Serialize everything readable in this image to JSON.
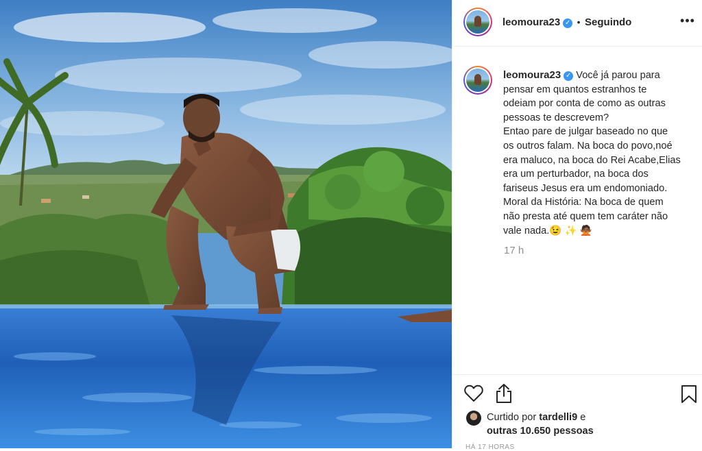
{
  "post": {
    "image_alt": "Homem agachado na borda de uma piscina com vista para vegetação e céu azul"
  },
  "header": {
    "username": "leomoura23",
    "verified_glyph": "✓",
    "separator": "•",
    "follow_status": "Seguindo",
    "more_icon": "more-options-icon",
    "more_glyph": "•••"
  },
  "caption": {
    "username": "leomoura23",
    "verified_glyph": "✓",
    "lines": [
      "Você já parou para",
      "pensar em quantos estranhos te",
      "odeiam por conta de como as outras",
      "pessoas te descrevem?",
      "Entao pare de julgar baseado no que",
      "os outros falam. Na boca do povo,noé",
      "era maluco, na boca do Rei Acabe,Elias",
      "era um perturbador, na boca dos",
      "fariseus Jesus era um endomoniado.",
      "Moral da História: Na boca de quem",
      "não presta até quem tem caráter não",
      "vale nada.😉 ✨ 🙅🏾"
    ],
    "time": "17 h"
  },
  "actions": {
    "like_icon": "heart-icon",
    "share_icon": "share-icon",
    "save_icon": "bookmark-icon"
  },
  "likes": {
    "prefix": "Curtido por ",
    "user": "tardelli9",
    "middle": " e",
    "others": "outras 10.650 pessoas"
  },
  "posted_ago": "HÁ 17 HORAS",
  "colors": {
    "verified": "#3897f0",
    "text": "#262626",
    "muted": "#8e8e8e",
    "border": "#efefef"
  }
}
